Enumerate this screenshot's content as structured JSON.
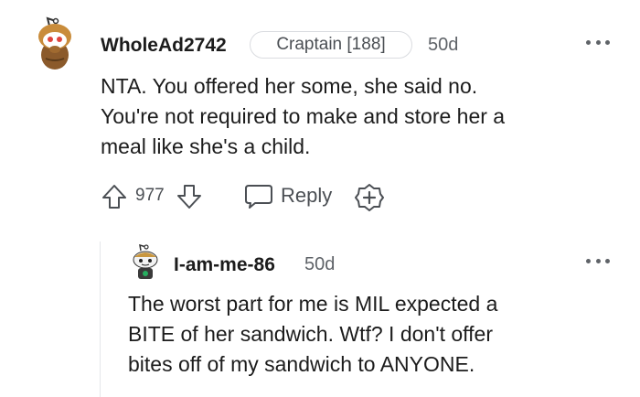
{
  "comment": {
    "username": "WholeAd2742",
    "flair": "Craptain [188]",
    "time": "50d",
    "body_lines": [
      "NTA. You offered her some, she said no.",
      "You're not required to make and store her a",
      "meal like she's a child."
    ],
    "score": "977",
    "reply_label": "Reply",
    "icons": {
      "avatar": "user-avatar-icon",
      "upvote": "arrow-up-icon",
      "downvote": "arrow-down-icon",
      "reply": "chat-bubble-icon",
      "award": "plus-badge-icon",
      "more": "ellipsis-icon"
    }
  },
  "reply": {
    "username": "I-am-me-86",
    "time": "50d",
    "body_lines": [
      "The worst part for me is MIL expected a",
      "BITE of her sandwich. Wtf? I don't offer",
      "bites off of my sandwich to ANYONE."
    ]
  },
  "colors": {
    "text": "#1c1c1c",
    "meta": "#5f6368",
    "border": "#dadce0"
  }
}
